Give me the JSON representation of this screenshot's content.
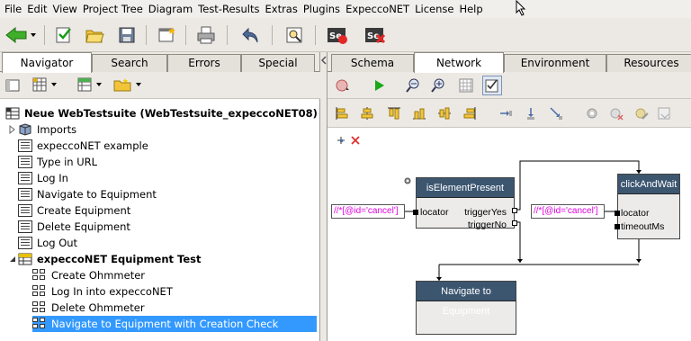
{
  "menu": [
    "File",
    "Edit",
    "View",
    "Project Tree",
    "Diagram",
    "Test-Results",
    "Extras",
    "Plugins",
    "ExpeccoNET",
    "License",
    "Help"
  ],
  "toolbar": {
    "icons": [
      "back-arrow-icon",
      "checklist-icon",
      "open-folder-icon",
      "save-disk-icon",
      "new-window-icon",
      "print-icon",
      "undo-icon",
      "find-icon",
      "selenium-record-icon",
      "selenium-stop-icon"
    ]
  },
  "left_tabs": [
    "Navigator",
    "Search",
    "Errors",
    "Special"
  ],
  "left_active_tab": "Navigator",
  "tree": {
    "root": "Neue WebTestsuite (WebTestsuite_expeccoNET08)",
    "items": [
      {
        "label": "Imports",
        "level": 1,
        "icon": "imports-icon",
        "expander": "collapsed"
      },
      {
        "label": "expeccoNET example",
        "level": 1,
        "icon": "grid-icon"
      },
      {
        "label": "Type in URL",
        "level": 1,
        "icon": "grid-icon"
      },
      {
        "label": "Log In",
        "level": 1,
        "icon": "grid-icon"
      },
      {
        "label": "Navigate to Equipment",
        "level": 1,
        "icon": "grid-icon"
      },
      {
        "label": "Create Equipment",
        "level": 1,
        "icon": "grid-icon"
      },
      {
        "label": "Delete Equipment",
        "level": 1,
        "icon": "grid-icon"
      },
      {
        "label": "Log Out",
        "level": 1,
        "icon": "grid-icon"
      },
      {
        "label": "expeccoNET Equipment Test",
        "level": 1,
        "icon": "testplan-icon",
        "expander": "expanded",
        "bold": true
      },
      {
        "label": "Create Ohmmeter",
        "level": 2,
        "icon": "block-icon"
      },
      {
        "label": "Log In into expeccoNET",
        "level": 2,
        "icon": "block-icon"
      },
      {
        "label": "Delete Ohmmeter",
        "level": 2,
        "icon": "block-icon"
      },
      {
        "label": "Navigate to Equipment with Creation Check",
        "level": 2,
        "icon": "block-icon",
        "selected": true
      }
    ]
  },
  "right_tabs": [
    "Schema",
    "Network",
    "Environment",
    "Resources"
  ],
  "right_active_tab": "Network",
  "network": {
    "nodes": {
      "is_element_present": {
        "title": "isElementPresent",
        "inputs": [
          "locator"
        ],
        "outputs": [
          "triggerYes",
          "triggerNo"
        ]
      },
      "click_and_wait": {
        "title": "clickAndWait",
        "inputs": [
          "locator",
          "timeoutMs"
        ]
      },
      "navigate": {
        "title": "Navigate to Equipment"
      }
    },
    "constants": [
      "//*[@id='cancel']",
      "//*[@id='cancel']"
    ]
  },
  "colors": {
    "selection": "#3399ff",
    "node_header": "#3c5670",
    "constant_text": "#e000e0"
  }
}
